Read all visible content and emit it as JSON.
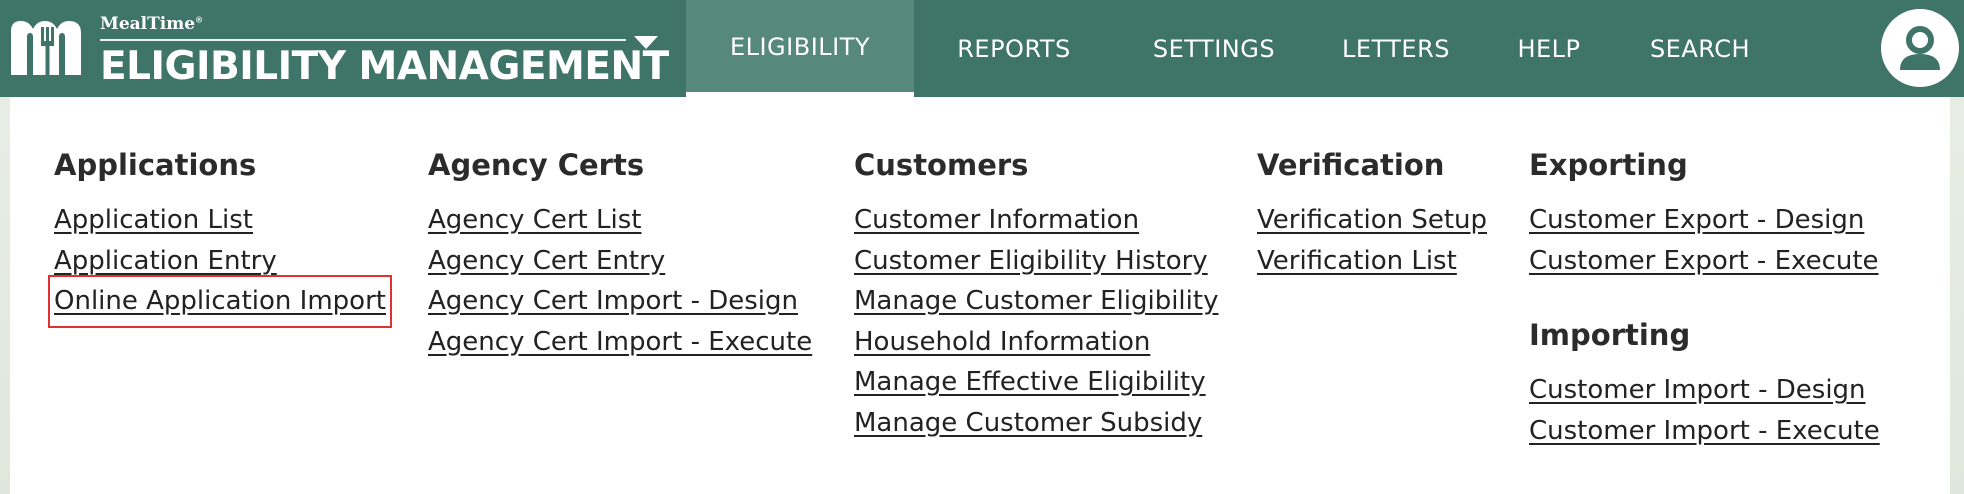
{
  "brand": {
    "small": "MealTime",
    "small_mark": "®",
    "title": "ELIGIBILITY MANAGEMENT"
  },
  "nav": {
    "items": [
      {
        "label": "ELIGIBILITY",
        "active": true
      },
      {
        "label": "REPORTS"
      },
      {
        "label": "SETTINGS"
      },
      {
        "label": "LETTERS"
      },
      {
        "label": "HELP"
      },
      {
        "label": "SEARCH"
      }
    ]
  },
  "menu": {
    "applications": {
      "title": "Applications",
      "links": [
        "Application List",
        "Application Entry",
        "Online Application Import"
      ],
      "highlighted": "Online Application Import"
    },
    "agency_certs": {
      "title": "Agency Certs",
      "links": [
        "Agency Cert List",
        "Agency Cert Entry",
        "Agency Cert Import - Design",
        "Agency Cert Import - Execute"
      ]
    },
    "customers": {
      "title": "Customers",
      "links": [
        "Customer Information",
        "Customer Eligibility History",
        "Manage Customer Eligibility",
        "Household Information",
        "Manage Effective Eligibility",
        "Manage Customer Subsidy"
      ]
    },
    "verification": {
      "title": "Verification",
      "links": [
        "Verification Setup",
        "Verification List"
      ]
    },
    "exporting": {
      "title": "Exporting",
      "links": [
        "Customer Export - Design",
        "Customer Export - Execute"
      ]
    },
    "importing": {
      "title": "Importing",
      "links": [
        "Customer Import - Design",
        "Customer Import - Execute"
      ]
    }
  },
  "colors": {
    "header": "#3f7468",
    "active_tab": "#56887c",
    "highlight_box": "#e03030"
  },
  "icons": {
    "brand_logo": "mealtime-m-fork-logo",
    "menu_caret": "chevron-down-icon",
    "user": "user-avatar-icon"
  }
}
